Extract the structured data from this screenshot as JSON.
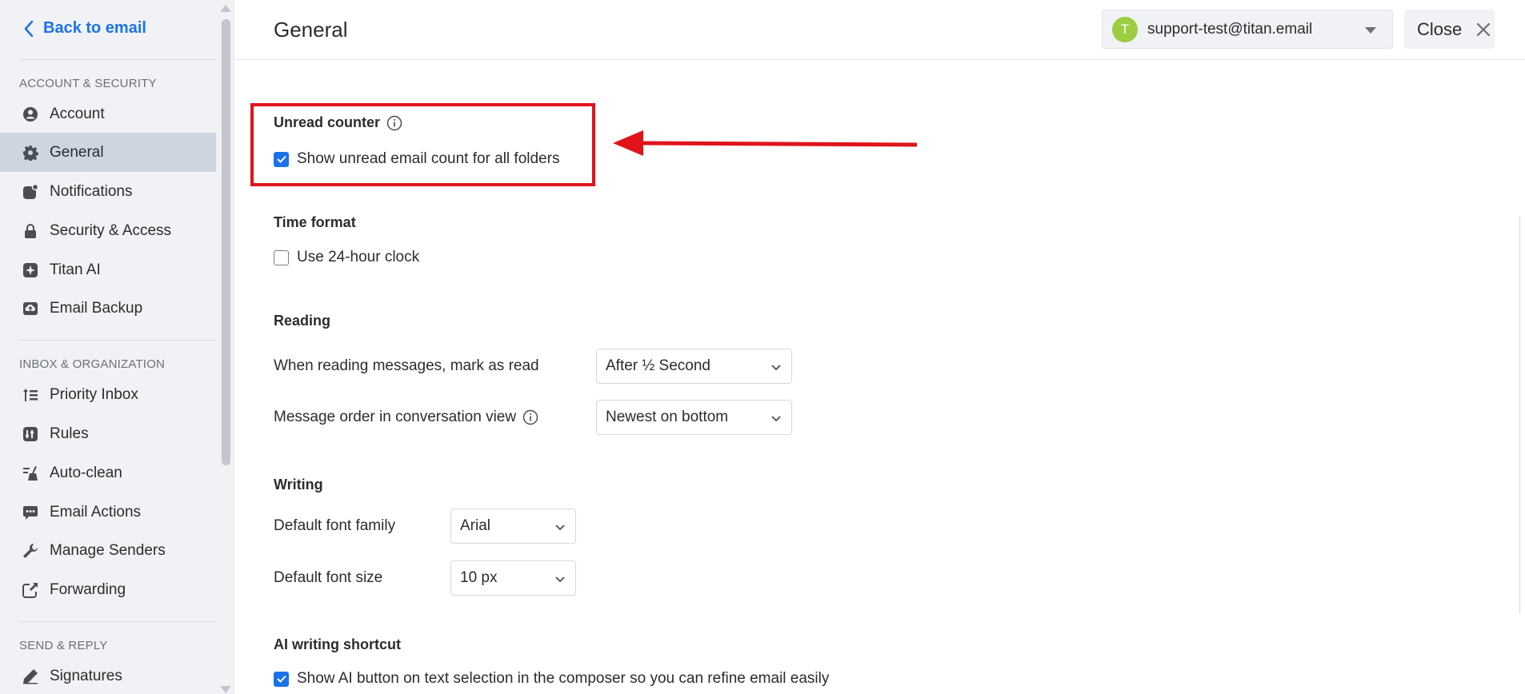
{
  "sidebar": {
    "back_label": "Back to email",
    "sections": {
      "account_security": "ACCOUNT & SECURITY",
      "inbox_organization": "INBOX & ORGANIZATION",
      "send_reply": "SEND & REPLY"
    },
    "items": [
      {
        "label": "Account",
        "icon": "user-circle-icon"
      },
      {
        "label": "General",
        "icon": "gear-icon",
        "active": true
      },
      {
        "label": "Notifications",
        "icon": "notification-icon"
      },
      {
        "label": "Security & Access",
        "icon": "lock-icon"
      },
      {
        "label": "Titan AI",
        "icon": "sparkle-icon"
      },
      {
        "label": "Email Backup",
        "icon": "cloud-upload-icon"
      },
      {
        "label": "Priority Inbox",
        "icon": "priority-list-icon"
      },
      {
        "label": "Rules",
        "icon": "rules-icon"
      },
      {
        "label": "Auto-clean",
        "icon": "broom-icon"
      },
      {
        "label": "Email Actions",
        "icon": "chat-dots-icon"
      },
      {
        "label": "Manage Senders",
        "icon": "wrench-icon"
      },
      {
        "label": "Forwarding",
        "icon": "forward-icon"
      },
      {
        "label": "Signatures",
        "icon": "pen-icon"
      }
    ]
  },
  "header": {
    "title": "General",
    "account": {
      "avatar_letter": "T",
      "avatar_color": "#9ccc3f",
      "email": "support-test@titan.email"
    },
    "close_label": "Close"
  },
  "main": {
    "unread_counter": {
      "heading": "Unread counter",
      "checkbox_label": "Show unread email count for all folders",
      "checked": true
    },
    "time_format": {
      "heading": "Time format",
      "checkbox_label": "Use 24-hour clock",
      "checked": false
    },
    "reading": {
      "heading": "Reading",
      "mark_read_label": "When reading messages, mark as read",
      "mark_read_value": "After ½ Second",
      "order_label": "Message order in conversation view",
      "order_value": "Newest on bottom"
    },
    "writing": {
      "heading": "Writing",
      "font_family_label": "Default font family",
      "font_family_value": "Arial",
      "font_size_label": "Default font size",
      "font_size_value": "10 px"
    },
    "ai_shortcut": {
      "heading": "AI writing shortcut",
      "checkbox_label": "Show AI button on text selection in the composer so you can refine email easily",
      "checked": true
    }
  },
  "colors": {
    "accent": "#1a73e8",
    "highlight": "#e0141a",
    "active_item_bg": "#cdd5e0"
  }
}
